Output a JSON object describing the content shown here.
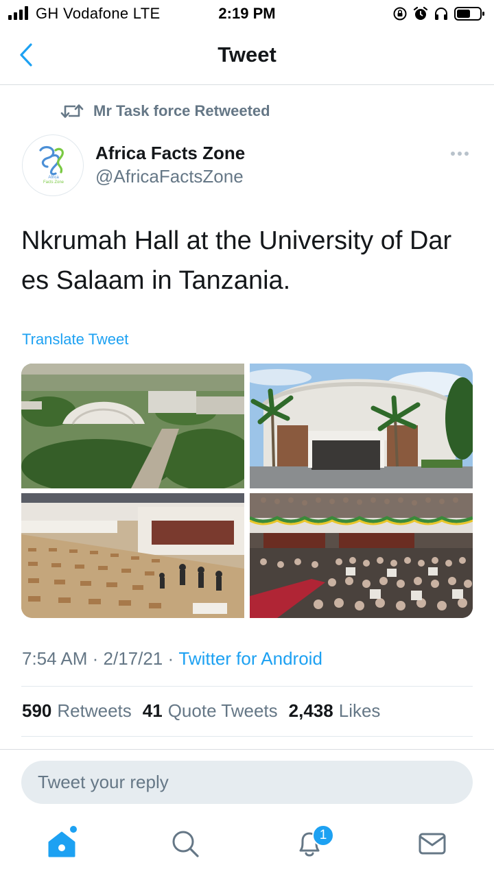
{
  "status_bar": {
    "carrier": "GH Vodafone  LTE",
    "time": "2:19 PM",
    "icons": [
      "signal-icon",
      "lock-rotation-icon",
      "alarm-icon",
      "headphones-icon",
      "battery-icon"
    ]
  },
  "nav": {
    "title": "Tweet",
    "back_icon": "chevron-left-icon"
  },
  "retweet_context": {
    "icon": "retweet-icon",
    "text": "Mr Task force Retweeted"
  },
  "author": {
    "name": "Africa Facts Zone",
    "handle": "@AfricaFactsZone",
    "avatar_text_line1": "Africa",
    "avatar_text_line2": "Facts Zone"
  },
  "tweet": {
    "text": "Nkrumah Hall at the University of Dar es Salaam in Tanzania.",
    "translate_label": "Translate Tweet",
    "media": [
      {
        "description": "aerial-campus-photo"
      },
      {
        "description": "nkrumah-hall-exterior-photo"
      },
      {
        "description": "exam-hall-interior-photo"
      },
      {
        "description": "crowded-auditorium-photo"
      }
    ],
    "time": "7:54 AM",
    "date": "2/17/21",
    "separator": " · ",
    "source": "Twitter for Android"
  },
  "stats": {
    "retweets_count": "590",
    "retweets_label": "Retweets",
    "quotes_count": "41",
    "quotes_label": "Quote Tweets",
    "likes_count": "2,438",
    "likes_label": "Likes"
  },
  "reply": {
    "placeholder": "Tweet your reply"
  },
  "tab_bar": {
    "notifications_badge": "1",
    "tabs": [
      "home-icon",
      "search-icon",
      "notifications-icon",
      "messages-icon"
    ]
  },
  "colors": {
    "accent": "#1da1f2",
    "secondary_text": "#657786",
    "primary_text": "#14171a",
    "divider": "#e1e8ed"
  }
}
